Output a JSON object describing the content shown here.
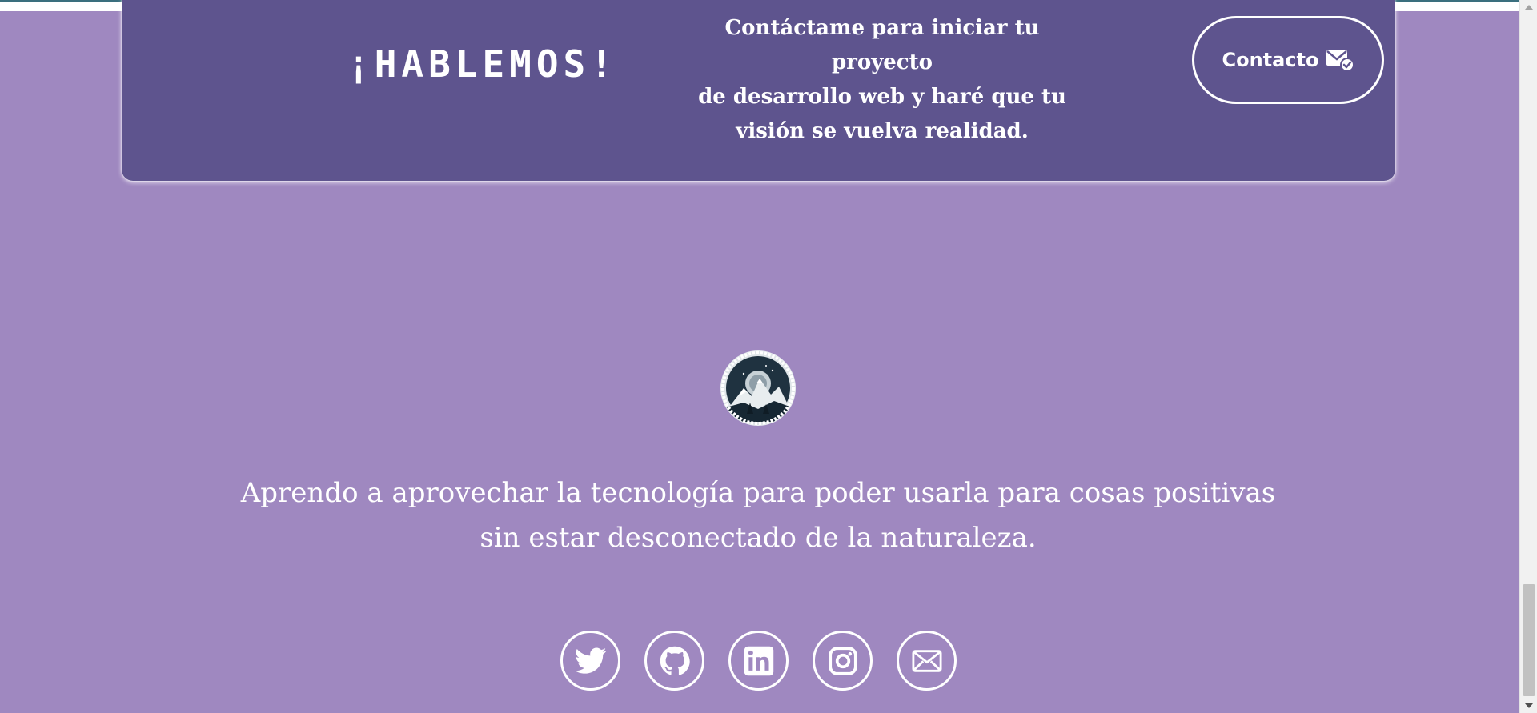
{
  "cta": {
    "heading": "¡HABLEMOS!",
    "text_lines": [
      "Contáctame para iniciar tu proyecto",
      "de desarrollo web y haré que tu",
      "visión se vuelva realidad."
    ],
    "button_label": "Contacto",
    "button_icon": "mail-check-icon"
  },
  "profile": {
    "avatar_icon": "mountain-moon-avatar",
    "tagline_lines": [
      "Aprendo a aprovechar la tecnología para poder usarla para cosas positivas",
      "sin estar desconectado de la naturaleza."
    ]
  },
  "social": [
    {
      "icon": "twitter-icon"
    },
    {
      "icon": "github-icon"
    },
    {
      "icon": "linkedin-icon"
    },
    {
      "icon": "instagram-icon"
    },
    {
      "icon": "email-icon"
    }
  ],
  "colors": {
    "page_background": "#9f88c0",
    "card_background": "#5e548e",
    "foreground": "#ffffff",
    "scroll_thumb": "#c1c1c1"
  }
}
